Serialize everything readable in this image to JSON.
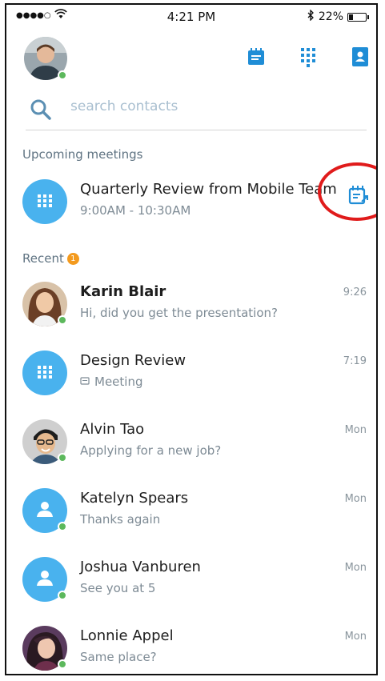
{
  "status_bar": {
    "time": "4:21 PM",
    "battery": "22%",
    "battery_level": 0.22
  },
  "header": {
    "icon_names": [
      "meetings-icon",
      "dialpad-icon",
      "contacts-icon"
    ]
  },
  "search": {
    "placeholder": "search contacts"
  },
  "sections": {
    "upcoming": "Upcoming meetings",
    "recent": "Recent",
    "recent_badge": "1"
  },
  "upcoming_meeting": {
    "title": "Quarterly Review from Mobile Team",
    "time": "9:00AM - 10:30AM"
  },
  "recent": [
    {
      "name": "Karin Blair",
      "message": "Hi, did you get the presentation?",
      "time": "9:26",
      "type": "person",
      "unread": true
    },
    {
      "name": "Design Review",
      "message": "Meeting",
      "time": "7:19",
      "type": "meeting"
    },
    {
      "name": "Alvin Tao",
      "message": "Applying for a new job?",
      "time": "Mon",
      "type": "person"
    },
    {
      "name": "Katelyn Spears",
      "message": "Thanks again",
      "time": "Mon",
      "type": "placeholder"
    },
    {
      "name": "Joshua Vanburen",
      "message": "See you at 5",
      "time": "Mon",
      "type": "placeholder"
    },
    {
      "name": "Lonnie Appel",
      "message": "Same place?",
      "time": "Mon",
      "type": "person"
    }
  ],
  "colors": {
    "accent": "#1f8dd6",
    "avatar_blue": "#49b2ee",
    "presence": "#5cb85c",
    "badge": "#f39a1e",
    "highlight_circle": "#e01b1b"
  }
}
